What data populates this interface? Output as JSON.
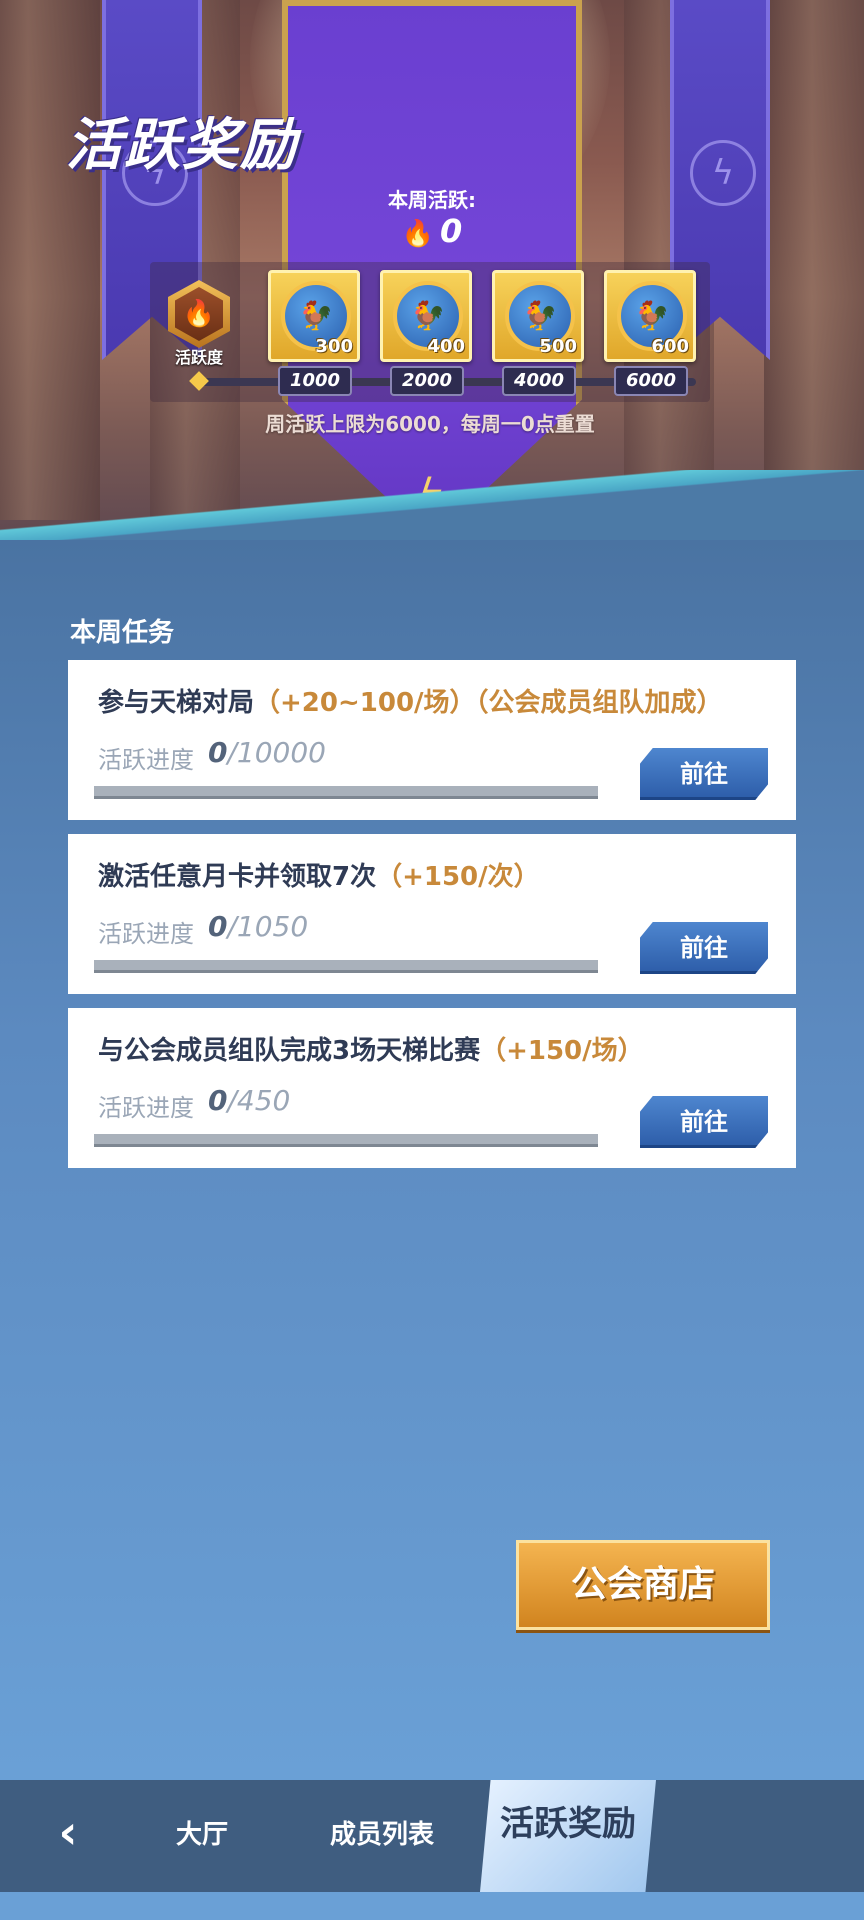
{
  "header": {
    "title": "活跃奖励",
    "week_label": "本周活跃:",
    "week_value": "0",
    "badge_label": "活跃度",
    "limit_note": "周活跃上限为6000，每周一0点重置"
  },
  "rewards": [
    {
      "amount": "300",
      "milestone": "1000"
    },
    {
      "amount": "400",
      "milestone": "2000"
    },
    {
      "amount": "500",
      "milestone": "4000"
    },
    {
      "amount": "600",
      "milestone": "6000"
    }
  ],
  "section_title": "本周任务",
  "tasks": [
    {
      "name": "参与天梯对局",
      "bonus": "（+20~100/场）（公会成员组队加成）",
      "progress_label": "活跃进度",
      "progress_current": "0",
      "progress_total": "/10000",
      "button": "前往"
    },
    {
      "name": "激活任意月卡并领取7次",
      "bonus": "（+150/次）",
      "progress_label": "活跃进度",
      "progress_current": "0",
      "progress_total": "/1050",
      "button": "前往"
    },
    {
      "name": "与公会成员组队完成3场天梯比赛",
      "bonus": "（+150/场）",
      "progress_label": "活跃进度",
      "progress_current": "0",
      "progress_total": "/450",
      "button": "前往"
    }
  ],
  "shop_button": "公会商店",
  "nav": {
    "tabs": [
      "大厅",
      "成员列表",
      "活跃奖励"
    ]
  }
}
